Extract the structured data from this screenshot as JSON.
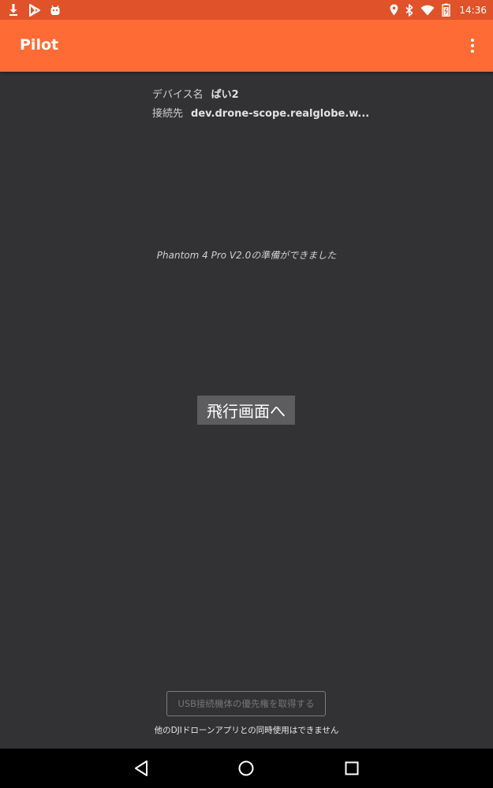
{
  "status_bar": {
    "time": "14:36",
    "left_icons": [
      "download-notification-icon",
      "play-store-icon",
      "android-debug-icon"
    ],
    "right_icons": [
      "location-icon",
      "bluetooth-icon",
      "wifi-icon",
      "battery-icon"
    ]
  },
  "app_bar": {
    "title": "Pilot",
    "menu_icon": "overflow-menu-icon",
    "color": "#ff6b35"
  },
  "device_info": {
    "name_label": "デバイス名",
    "name_value": "ぱい2",
    "connection_label": "接続先",
    "connection_value": "dev.drone-scope.realglobe.w..."
  },
  "status_message": "Phantom 4 Pro V2.0の準備ができました",
  "flight_button_label": "飛行画面へ",
  "usb": {
    "button_label": "USB接続機体の優先権を取得する",
    "note": "他のDJIドローンアプリとの同時使用はできません"
  },
  "nav_bar": {
    "icons": [
      "back-icon",
      "home-icon",
      "recents-icon"
    ]
  }
}
